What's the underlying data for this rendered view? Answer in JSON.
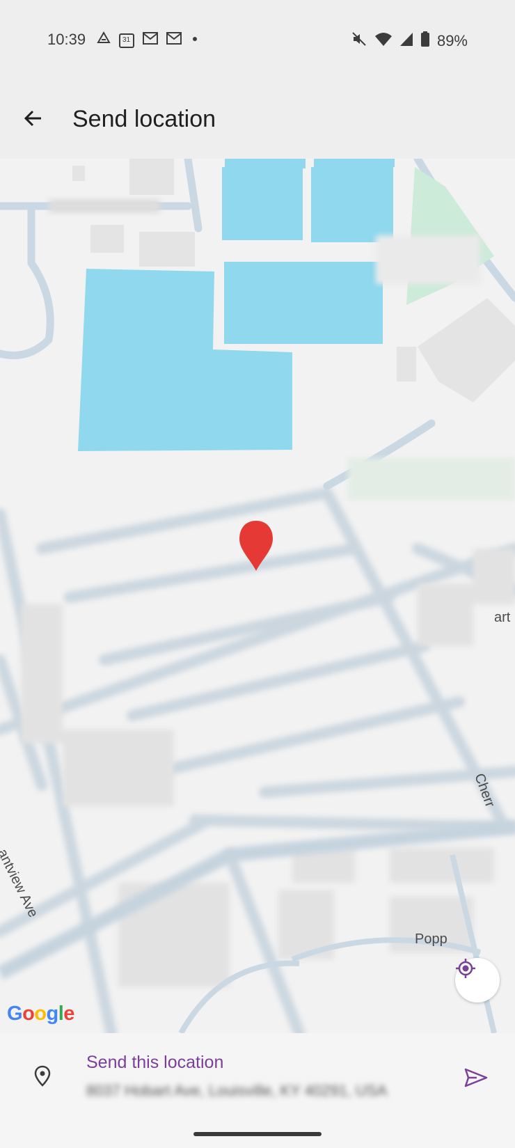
{
  "status_bar": {
    "time": "10:39",
    "calendar_day": "31",
    "battery_percent": "89%",
    "icons": [
      "drive-icon",
      "calendar-icon",
      "mail-icon",
      "mail-icon",
      "dot-icon",
      "mute-icon",
      "wifi-icon",
      "signal-icon",
      "battery-icon"
    ]
  },
  "toolbar": {
    "title": "Send location",
    "back_icon": "arrow-back-icon"
  },
  "map": {
    "logo": [
      "G",
      "o",
      "o",
      "g",
      "l",
      "e"
    ],
    "logo_colors": [
      "#4285F4",
      "#EA4335",
      "#FBBC05",
      "#4285F4",
      "#34A853",
      "#EA4335"
    ],
    "street_labels": {
      "cherry": "Cherr",
      "poppy": "Popp",
      "art": "art",
      "avenue": "antview Ave"
    },
    "building_color": "#8fd8ee",
    "park_color": "#cdebd9",
    "road_color": "#c9d8e3",
    "marker_color": "#e53935"
  },
  "bottom_sheet": {
    "title": "Send this location",
    "address": "8037 Hobart Ave, Louisville, KY 40291, USA",
    "accent_color": "#7b3f99"
  }
}
